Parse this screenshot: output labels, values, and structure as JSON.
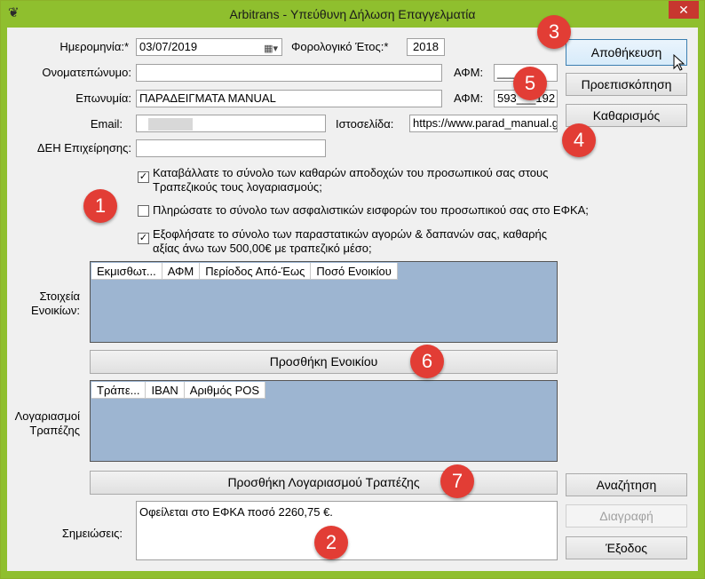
{
  "window": {
    "title": "Arbitrans - Υπεύθυνη Δήλωση Επαγγελματία",
    "close": "✕"
  },
  "form": {
    "date_label": "Ημερομηνία:*",
    "date_value": "03/07/2019",
    "fiscal_label": "Φορολογικό Έτος:*",
    "fiscal_value": "2018",
    "fullname_label": "Ονοματεπώνυμο:",
    "fullname_value": "",
    "afm_label_1": "ΑΦΜ:",
    "afm_value_1": "____",
    "company_label": "Επωνυμία:",
    "company_value": "ΠΑΡΑΔΕΙΓΜΑΤΑ MANUAL",
    "afm_label_2": "ΑΦΜ:",
    "afm_value_2": "593___192",
    "email_label": "Email:",
    "email_value": "",
    "website_label": "Ιστοσελίδα:",
    "website_value": "https://www.parad_manual.g",
    "deh_label": "ΔΕΗ Επιχείρησης:",
    "deh_value": ""
  },
  "checks": [
    {
      "text": "Καταβάλλατε το σύνολο των καθαρών αποδοχών του προσωπικού σας στους Τραπεζικούς τους λογαριασμούς;",
      "checked": true
    },
    {
      "text": "Πληρώσατε το σύνολο των ασφαλιστικών εισφορών του προσωπικού σας στο ΕΦΚΑ;",
      "checked": false
    },
    {
      "text": "Εξοφλήσατε το σύνολο των παραστατικών αγορών & δαπανών σας, καθαρής αξίας άνω των 500,00€ με τραπεζικό μέσο;",
      "checked": true
    }
  ],
  "rentals": {
    "label": "Στοιχεία Ενοικίων:",
    "columns": [
      "Εκμισθωτ...",
      "ΑΦΜ",
      "Περίοδος Από-Έως",
      "Ποσό Ενοικίου"
    ],
    "add_button": "Προσθήκη Ενοικίου"
  },
  "banks": {
    "label": "Λογαριασμοί Τραπέζης",
    "columns": [
      "Τράπε...",
      "IBAN",
      "Αριθμός POS"
    ],
    "add_button": "Προσθήκη Λογαριασμού Τραπέζης"
  },
  "notes": {
    "label": "Σημειώσεις:",
    "value": "Οφείλεται στο ΕΦΚΑ ποσό 2260,75 €."
  },
  "buttons": {
    "save": "Αποθήκευση",
    "preview": "Προεπισκόπηση",
    "clear": "Καθαρισμός",
    "search": "Αναζήτηση",
    "delete": "Διαγραφή",
    "exit": "Έξοδος"
  },
  "badges": [
    "1",
    "2",
    "3",
    "4",
    "5",
    "6",
    "7"
  ],
  "colors": {
    "titlebar": "#8fbf2e",
    "badge": "#e23d35",
    "grid": "#9db5d1"
  }
}
